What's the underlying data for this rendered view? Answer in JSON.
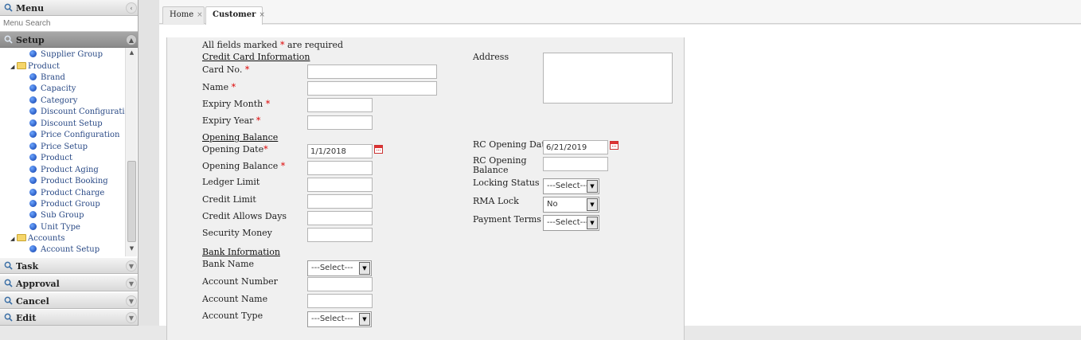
{
  "sidebar": {
    "menu_label": "Menu",
    "search_placeholder": "Menu Search",
    "setup_label": "Setup",
    "tree": {
      "supplier_group": "Supplier Group",
      "product": "Product",
      "product_items": [
        "Brand",
        "Capacity",
        "Category",
        "Discount Configuration",
        "Discount Setup",
        "Price Configuration",
        "Price Setup",
        "Product",
        "Product Aging",
        "Product Booking",
        "Product Charge",
        "Product Group",
        "Sub Group",
        "Unit Type"
      ],
      "accounts": "Accounts",
      "account_setup": "Account Setup"
    },
    "sections": [
      "Task",
      "Approval",
      "Cancel",
      "Edit"
    ]
  },
  "tabs": [
    {
      "label": "Home",
      "close": "×"
    },
    {
      "label": "Customer",
      "close": "×"
    }
  ],
  "form": {
    "required_note_prefix": "All fields marked",
    "required_star": "*",
    "required_note_suffix": "are required",
    "credit_card_heading": "Credit Card Information",
    "card_no": "Card No.",
    "name": "Name",
    "expiry_month": "Expiry Month",
    "expiry_year": "Expiry Year",
    "opening_balance_heading": "Opening Balance",
    "opening_date": "Opening Date",
    "opening_date_value": "1/1/2018",
    "opening_balance": "Opening Balance",
    "ledger_limit": "Ledger Limit",
    "credit_limit": "Credit Limit",
    "credit_allows_days": "Credit Allows Days",
    "security_money": "Security Money",
    "bank_heading": "Bank Information",
    "bank_name": "Bank Name",
    "account_number": "Account Number",
    "account_name": "Account Name",
    "account_type": "Account Type",
    "select_placeholder": "---Select---",
    "address": "Address",
    "rc_opening_date": "RC Opening Date",
    "rc_opening_date_value": "6/21/2019",
    "rc_opening_balance": "RC Opening Balance",
    "locking_status": "Locking Status",
    "rma_lock": "RMA Lock",
    "rma_lock_value": "No",
    "payment_terms": "Payment Terms"
  }
}
